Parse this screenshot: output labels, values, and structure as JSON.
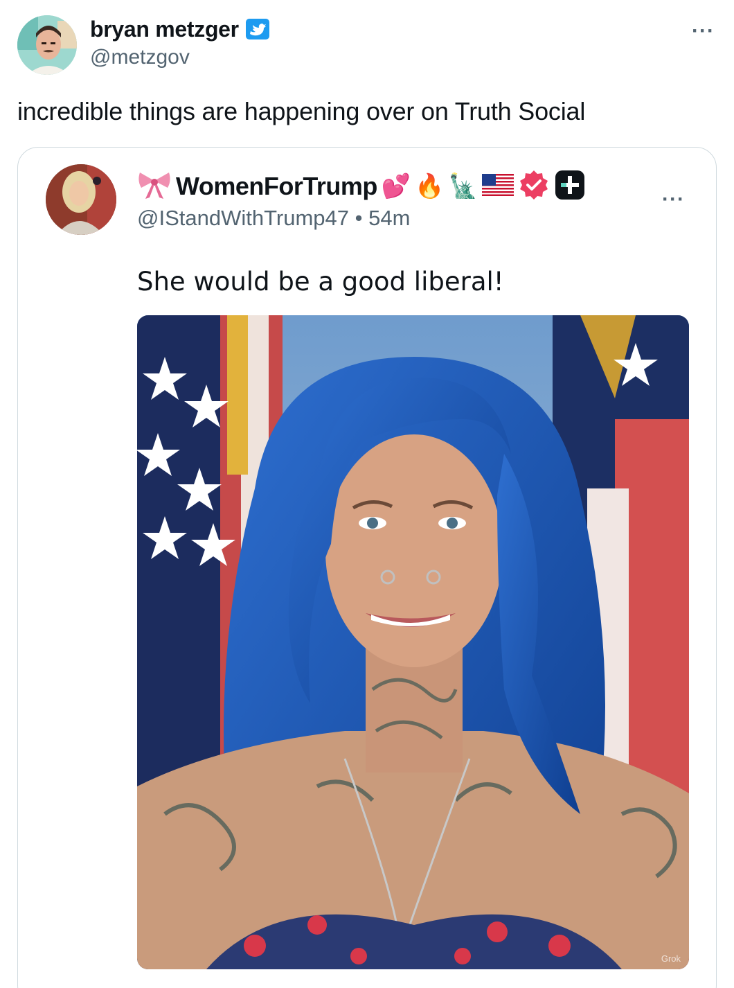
{
  "tweet": {
    "display_name": "bryan metzger",
    "handle": "@metzgov",
    "more": "···",
    "text": "incredible things are happening over on Truth Social",
    "avatar_icon": "user-avatar",
    "badge_icon": "twitter-bird-verified-badge"
  },
  "quote": {
    "display_name": "WomenForTrump",
    "emojis": [
      "💕",
      "🔥",
      "🗽",
      "🇺🇸"
    ],
    "ribbon_icon": "pink-ribbon-icon",
    "handle": "@IStandWithTrump47",
    "separator": "•",
    "time": "54m",
    "more": "···",
    "text": "She would be a good liberal!",
    "image_watermark": "Grok"
  },
  "colors": {
    "text": "#0f1419",
    "secondary": "#536471",
    "twitter_blue": "#1d9bf0",
    "border": "#cfd9de",
    "truth_verified": "#ec3e62"
  }
}
